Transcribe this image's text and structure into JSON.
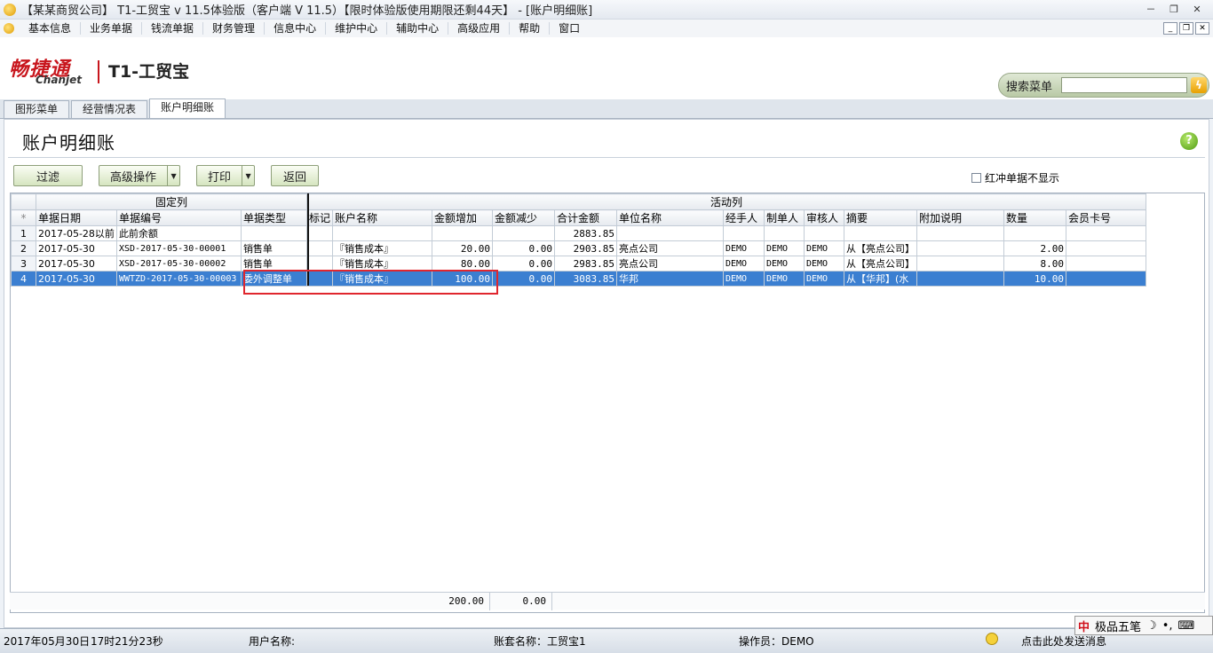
{
  "window": {
    "title": "【某某商贸公司】 T1-工贸宝 v 11.5体验版（客户端 V 11.5）【限时体验版使用期限还剩44天】 - [账户明细账]",
    "buttons": [
      "－",
      "❐",
      "✕"
    ]
  },
  "menubar": {
    "items": [
      "基本信息",
      "业务单据",
      "钱流单据",
      "财务管理",
      "信息中心",
      "维护中心",
      "辅助中心",
      "高级应用",
      "帮助",
      "窗口"
    ],
    "mdi_buttons": [
      "_",
      "❐",
      "✕"
    ]
  },
  "logo": {
    "cn": "畅捷通",
    "en": "Chanjet",
    "product": "T1-工贸宝"
  },
  "search": {
    "label": "搜索菜单",
    "value": "",
    "go_icon": "lightning-icon"
  },
  "tabs": [
    "图形菜单",
    "经营情况表",
    "账户明细账"
  ],
  "active_tab": 2,
  "page": {
    "title": "账户明细账",
    "help_icon": "?"
  },
  "toolbar": {
    "filter": "过滤",
    "advanced": "高级操作",
    "print": "打印",
    "back": "返回",
    "red_flag_label": "红冲单据不显示"
  },
  "grid": {
    "group_fixed": "固定列",
    "group_active": "活动列",
    "corner": "*",
    "columns": [
      "单据日期",
      "单据编号",
      "单据类型",
      "标记",
      "账户名称",
      "金额增加",
      "金额减少",
      "合计金额",
      "单位名称",
      "经手人",
      "制单人",
      "审核人",
      "摘要",
      "附加说明",
      "数量",
      "会员卡号"
    ],
    "rows": [
      {
        "rn": "1",
        "date": "2017-05-28以前",
        "no": "此前余额",
        "type": "",
        "flag": "",
        "account": "",
        "inc": "",
        "dec": "",
        "total": "2883.85",
        "unit": "",
        "handler": "",
        "maker": "",
        "auditor": "",
        "summary": "",
        "note": "",
        "qty": "",
        "card": ""
      },
      {
        "rn": "2",
        "date": "2017-05-30",
        "no": "XSD-2017-05-30-00001",
        "type": "销售单",
        "flag": "",
        "account": "『销售成本』",
        "inc": "20.00",
        "dec": "0.00",
        "total": "2903.85",
        "unit": "亮点公司",
        "handler": "DEMO",
        "maker": "DEMO",
        "auditor": "DEMO",
        "summary": "从【亮点公司】",
        "note": "",
        "qty": "2.00",
        "card": ""
      },
      {
        "rn": "3",
        "date": "2017-05-30",
        "no": "XSD-2017-05-30-00002",
        "type": "销售单",
        "flag": "",
        "account": "『销售成本』",
        "inc": "80.00",
        "dec": "0.00",
        "total": "2983.85",
        "unit": "亮点公司",
        "handler": "DEMO",
        "maker": "DEMO",
        "auditor": "DEMO",
        "summary": "从【亮点公司】",
        "note": "",
        "qty": "8.00",
        "card": ""
      },
      {
        "rn": "4",
        "date": "2017-05-30",
        "no": "WWTZD-2017-05-30-00003",
        "type": "委外调整单",
        "flag": "",
        "account": "『销售成本』",
        "inc": "100.00",
        "dec": "0.00",
        "total": "3083.85",
        "unit": "华邦",
        "handler": "DEMO",
        "maker": "DEMO",
        "auditor": "DEMO",
        "summary": "从【华邦】(水",
        "note": "",
        "qty": "10.00",
        "card": ""
      }
    ],
    "totals": {
      "inc": "200.00",
      "dec": "0.00"
    }
  },
  "status": {
    "date": "2017年05月30日",
    "time": "17时21分23秒",
    "user_label": "用户名称:",
    "account_set": "账套名称：工贸宝1",
    "operator": "操作员：DEMO",
    "message": "点击此处发送消息"
  },
  "ime": {
    "zh": "中",
    "name": "极品五笔",
    "moon": "☽",
    "dots": "•,",
    "keyboard": "⌨"
  }
}
